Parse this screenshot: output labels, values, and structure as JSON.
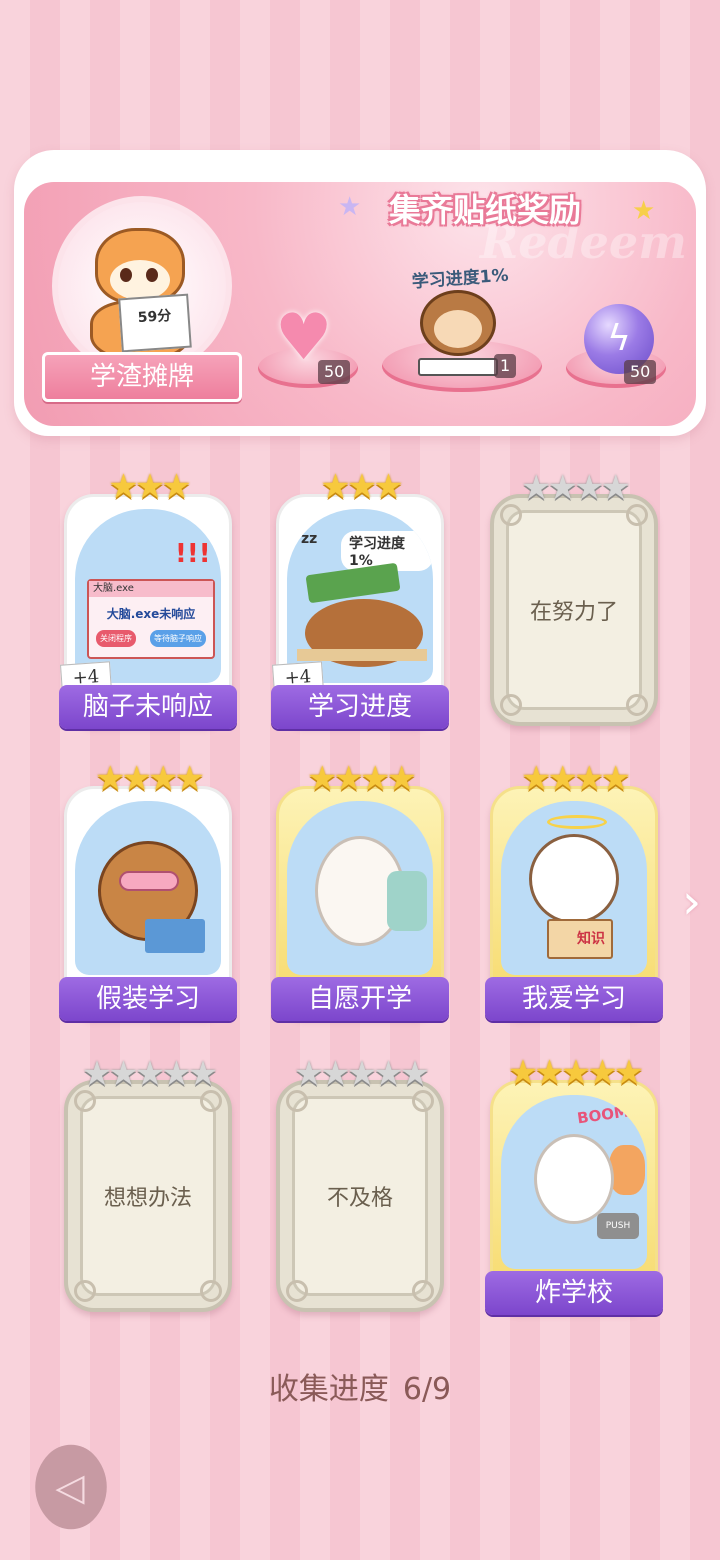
{
  "banner": {
    "title": "集齐贴纸奖励",
    "watermark": "Redeem",
    "avatar_paper_text": "59分",
    "avatar_ribbon": "学渣摊牌",
    "center_caption": "学习进度1%",
    "rewards": [
      {
        "icon": "pink-heart-gem-icon",
        "count": "50"
      },
      {
        "icon": "monkey-sticker-icon",
        "count": "1"
      },
      {
        "icon": "purple-energy-orb-icon",
        "count": "50"
      }
    ]
  },
  "cards": [
    {
      "label": "脑子未响应",
      "stars": 3,
      "max_stars": 3,
      "unlocked": true,
      "bonus": "+4",
      "window": {
        "title": "大脑.exe",
        "message": "大脑.exe未响应",
        "btn_close": "关闭程序",
        "btn_wait": "等待脑子响应"
      },
      "exclaim": "!!!"
    },
    {
      "label": "学习进度",
      "stars": 3,
      "max_stars": 3,
      "unlocked": true,
      "bonus": "+4",
      "caption": "学习进度1%",
      "zz": "zz"
    },
    {
      "label": "在努力了",
      "stars": 0,
      "max_stars": 4,
      "unlocked": false
    },
    {
      "label": "假装学习",
      "stars": 4,
      "max_stars": 4,
      "unlocked": true
    },
    {
      "label": "自愿开学",
      "stars": 4,
      "max_stars": 4,
      "unlocked": true
    },
    {
      "label": "我爱学习",
      "stars": 4,
      "max_stars": 4,
      "unlocked": true,
      "book_text": "知识"
    },
    {
      "label": "想想办法",
      "stars": 0,
      "max_stars": 5,
      "unlocked": false
    },
    {
      "label": "不及格",
      "stars": 0,
      "max_stars": 5,
      "unlocked": false
    },
    {
      "label": "炸学校",
      "stars": 5,
      "max_stars": 5,
      "unlocked": true,
      "boom": "BOOM!!",
      "push": "PUSH"
    }
  ],
  "progress": {
    "label": "收集进度",
    "value": "6/9"
  },
  "nav": {
    "next_icon": "chevron-right-icon",
    "back_icon": "back-arrow-icon"
  }
}
